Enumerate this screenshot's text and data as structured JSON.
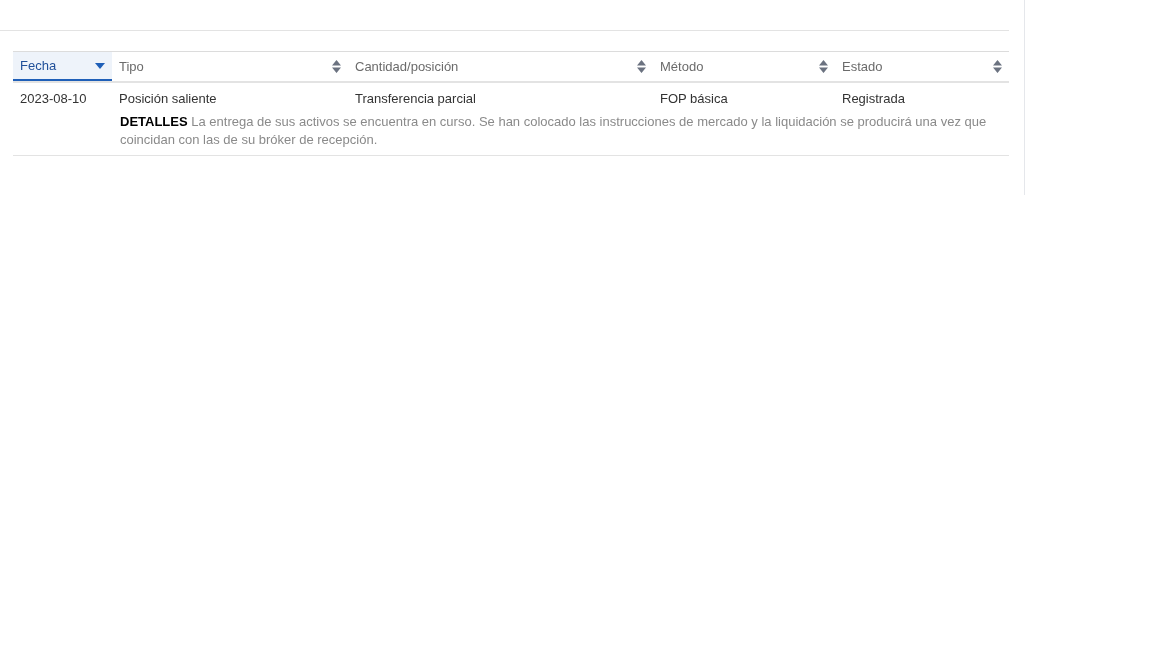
{
  "table": {
    "columns": [
      {
        "label": "Fecha",
        "selected": true
      },
      {
        "label": "Tipo",
        "selected": false
      },
      {
        "label": "Cantidad/posición",
        "selected": false
      },
      {
        "label": "Método",
        "selected": false
      },
      {
        "label": "Estado",
        "selected": false
      }
    ],
    "rows": [
      {
        "cells": [
          "2023-08-10",
          "Posición saliente",
          "Transferencia parcial",
          "FOP básica",
          "Registrada"
        ],
        "details": "**DETALLES** La entrega de sus activos se encuentra en curso. Se han colocado las instrucciones de mercado y la liquidación se producirá una vez que coincidan con las de su bróker de recepción."
      }
    ]
  }
}
